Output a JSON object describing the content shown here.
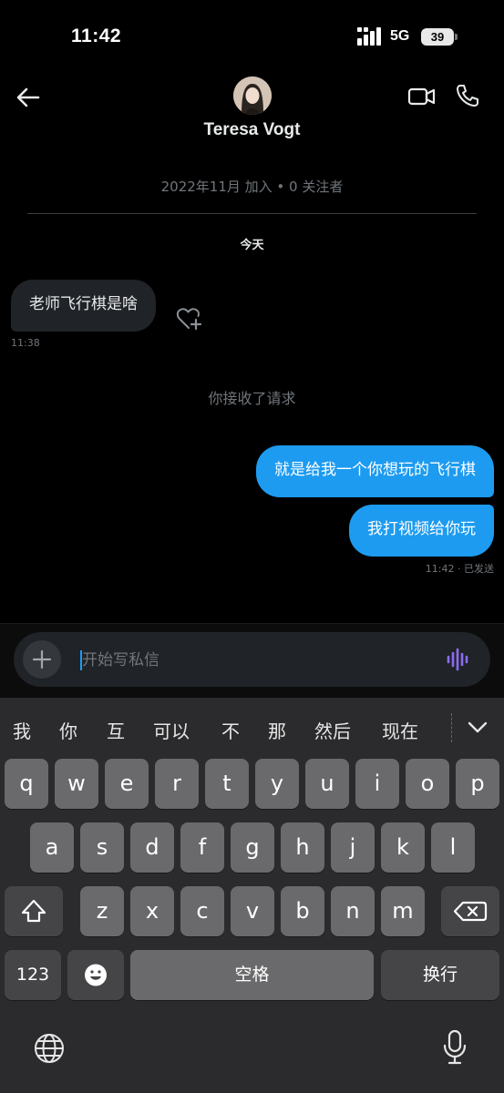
{
  "status_bar": {
    "time": "11:42",
    "network": "5G",
    "battery": "39"
  },
  "header": {
    "contact_name": "Teresa Vogt",
    "meta": "2022年11月 加入 • 0 关注者",
    "icons": {
      "back": "arrow-left-icon",
      "video": "video-camera-icon",
      "phone": "phone-icon"
    }
  },
  "conversation": {
    "date_separator": "今天",
    "messages": [
      {
        "direction": "incoming",
        "text": "老师飞行棋是啥",
        "time": "11:38"
      },
      {
        "direction": "system",
        "text": "你接收了请求"
      },
      {
        "direction": "outgoing",
        "text": "就是给我一个你想玩的飞行棋"
      },
      {
        "direction": "outgoing",
        "text": "我打视频给你玩"
      }
    ],
    "outgoing_status": "11:42 · 已发送"
  },
  "composer": {
    "placeholder": "开始写私信"
  },
  "keyboard": {
    "candidates": [
      "我",
      "你",
      "互",
      "可以",
      "不",
      "那",
      "然后",
      "现在"
    ],
    "rows": [
      [
        "q",
        "w",
        "e",
        "r",
        "t",
        "y",
        "u",
        "i",
        "o",
        "p"
      ],
      [
        "a",
        "s",
        "d",
        "f",
        "g",
        "h",
        "j",
        "k",
        "l"
      ],
      [
        "z",
        "x",
        "c",
        "v",
        "b",
        "n",
        "m"
      ]
    ],
    "numbers_label": "123",
    "space_label": "空格",
    "return_label": "换行"
  },
  "colors": {
    "accent": "#1d9bf0",
    "incoming_bubble": "#202327",
    "muted_text": "#71767b",
    "background": "#000000"
  }
}
